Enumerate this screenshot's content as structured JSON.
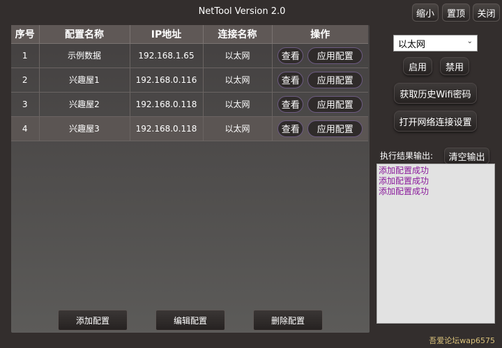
{
  "window": {
    "title": "NetTool Version 2.0",
    "minimize_label": "缩小",
    "top_label": "置顶",
    "close_label": "关闭"
  },
  "table": {
    "headers": [
      "序号",
      "配置名称",
      "IP地址",
      "连接名称",
      "操作"
    ],
    "rows": [
      {
        "index": "1",
        "name": "示例数据",
        "ip": "192.168.1.65",
        "conn": "以太网",
        "view": "查看",
        "apply": "应用配置"
      },
      {
        "index": "2",
        "name": "兴趣屋1",
        "ip": "192.168.0.116",
        "conn": "以太网",
        "view": "查看",
        "apply": "应用配置"
      },
      {
        "index": "3",
        "name": "兴趣屋2",
        "ip": "192.168.0.118",
        "conn": "以太网",
        "view": "查看",
        "apply": "应用配置"
      },
      {
        "index": "4",
        "name": "兴趣屋3",
        "ip": "192.168.0.118",
        "conn": "以太网",
        "view": "查看",
        "apply": "应用配置"
      }
    ]
  },
  "bottom": {
    "add_label": "添加配置",
    "edit_label": "编辑配置",
    "delete_label": "删除配置"
  },
  "side": {
    "adapter_selected": "以太网",
    "enable_label": "启用",
    "disable_label": "禁用",
    "wifi_label": "获取历史Wifi密码",
    "netsettings_label": "打开网络连接设置",
    "output_label": "执行结果输出:",
    "clear_label": "清空输出",
    "output_lines": [
      "添加配置成功",
      "添加配置成功",
      "添加配置成功"
    ]
  },
  "footer": {
    "watermark": "吾爱论坛wap6575"
  },
  "icons": {
    "dropdown": "chevron-down-icon"
  }
}
